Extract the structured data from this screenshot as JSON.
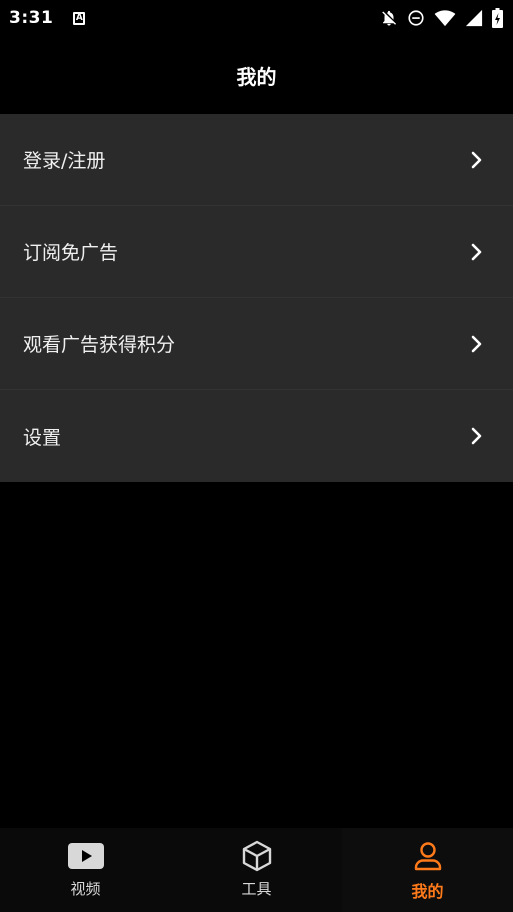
{
  "status_bar": {
    "time": "3:31",
    "notification_glyph": "A"
  },
  "header": {
    "title": "我的"
  },
  "menu": [
    {
      "label": "登录/注册"
    },
    {
      "label": "订阅免广告"
    },
    {
      "label": "观看广告获得积分"
    },
    {
      "label": "设置"
    }
  ],
  "bottom_nav": [
    {
      "label": "视频",
      "icon": "play-video-icon"
    },
    {
      "label": "工具",
      "icon": "cube-icon"
    },
    {
      "label": "我的",
      "icon": "person-icon",
      "active": true
    }
  ],
  "colors": {
    "background": "#000000",
    "menu_item_bg": "#2a2a2a",
    "accent": "#ff7a1a"
  }
}
